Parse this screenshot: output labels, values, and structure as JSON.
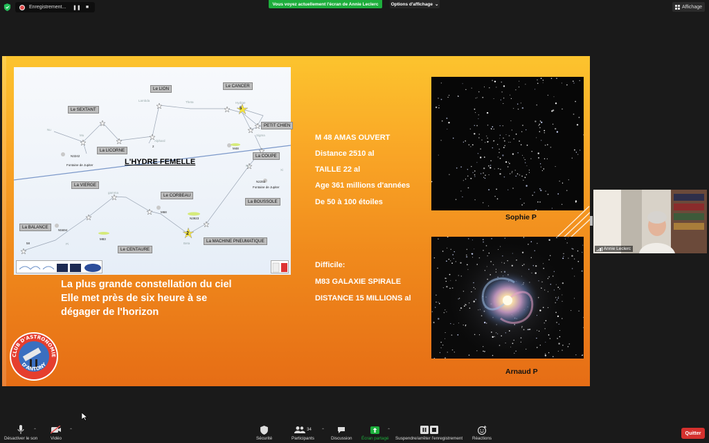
{
  "top_bar": {
    "recording_label": "Enregistrement...",
    "recording_pause": "❚❚",
    "recording_stop": "■",
    "share_banner": "Vous voyez actuellement l'écran de Annie Leclerc",
    "view_options": "Options d'affichage",
    "display_button": "Affichage"
  },
  "slide": {
    "map": {
      "title": "L'HYDRE FEMELLE",
      "constellations": [
        "Le LION",
        "Le CANCER",
        "Le SEXTANT",
        "PETIT CHIEN",
        "La LICORNE",
        "La COUPE",
        "La VIERGE",
        "Le CORBEAU",
        "La BOUSSOLE",
        "La BALANCE",
        "La MACHINE PNEUMATIQUE",
        "Le CENTAURE"
      ],
      "small_labels": [
        "Lambda",
        "Theta",
        "Hydrae",
        "Sigma",
        "Mu",
        "Nu",
        "Alphard",
        "2",
        "N3242",
        "Fontaine de Jupiter",
        "M48",
        "Xi",
        "Nu",
        "N2252",
        "Fontaine de Jupiter",
        "gamma",
        "M68",
        "N5694",
        "M83",
        "N3923",
        "58",
        "Pi",
        "Beta"
      ],
      "star_markers": [
        "5",
        "2"
      ]
    },
    "caption_lines": [
      "La plus grande constellation du ciel",
      "Elle met près de six heure à se",
      "dégager de l'horizon"
    ],
    "info_block_1": [
      "M 48 AMAS OUVERT",
      "Distance 2510 al",
      "TAILLE 22 al",
      "Age 361 millions d'années",
      "De 50 à 100 étoiles"
    ],
    "info_block_2": [
      "Difficile:",
      "M83 GALAXIE SPIRALE",
      "DISTANCE 15 MILLIONS al"
    ],
    "photo_credits": [
      "Sophie P",
      "Arnaud P"
    ],
    "logo": {
      "top_text": "CLUB D'ASTRONOMIE",
      "bottom_text": "D'ANTONY"
    }
  },
  "video": {
    "participant_name": "Annie Leclerc"
  },
  "toolbar": {
    "mute_label": "Désactiver le son",
    "video_label": "Vidéo",
    "security_label": "Sécurité",
    "participants_label": "Participants",
    "participants_count": "34",
    "chat_label": "Discussion",
    "share_label": "Écran partagé",
    "record_label": "Suspendre/arrêter l'enregistrement",
    "reactions_label": "Réactions",
    "quit_label": "Quitter"
  },
  "colors": {
    "share_green": "#1dae3c",
    "quit_red": "#d5312e",
    "slide_orange_top": "#fcc42e",
    "slide_orange_bottom": "#e66d15"
  }
}
